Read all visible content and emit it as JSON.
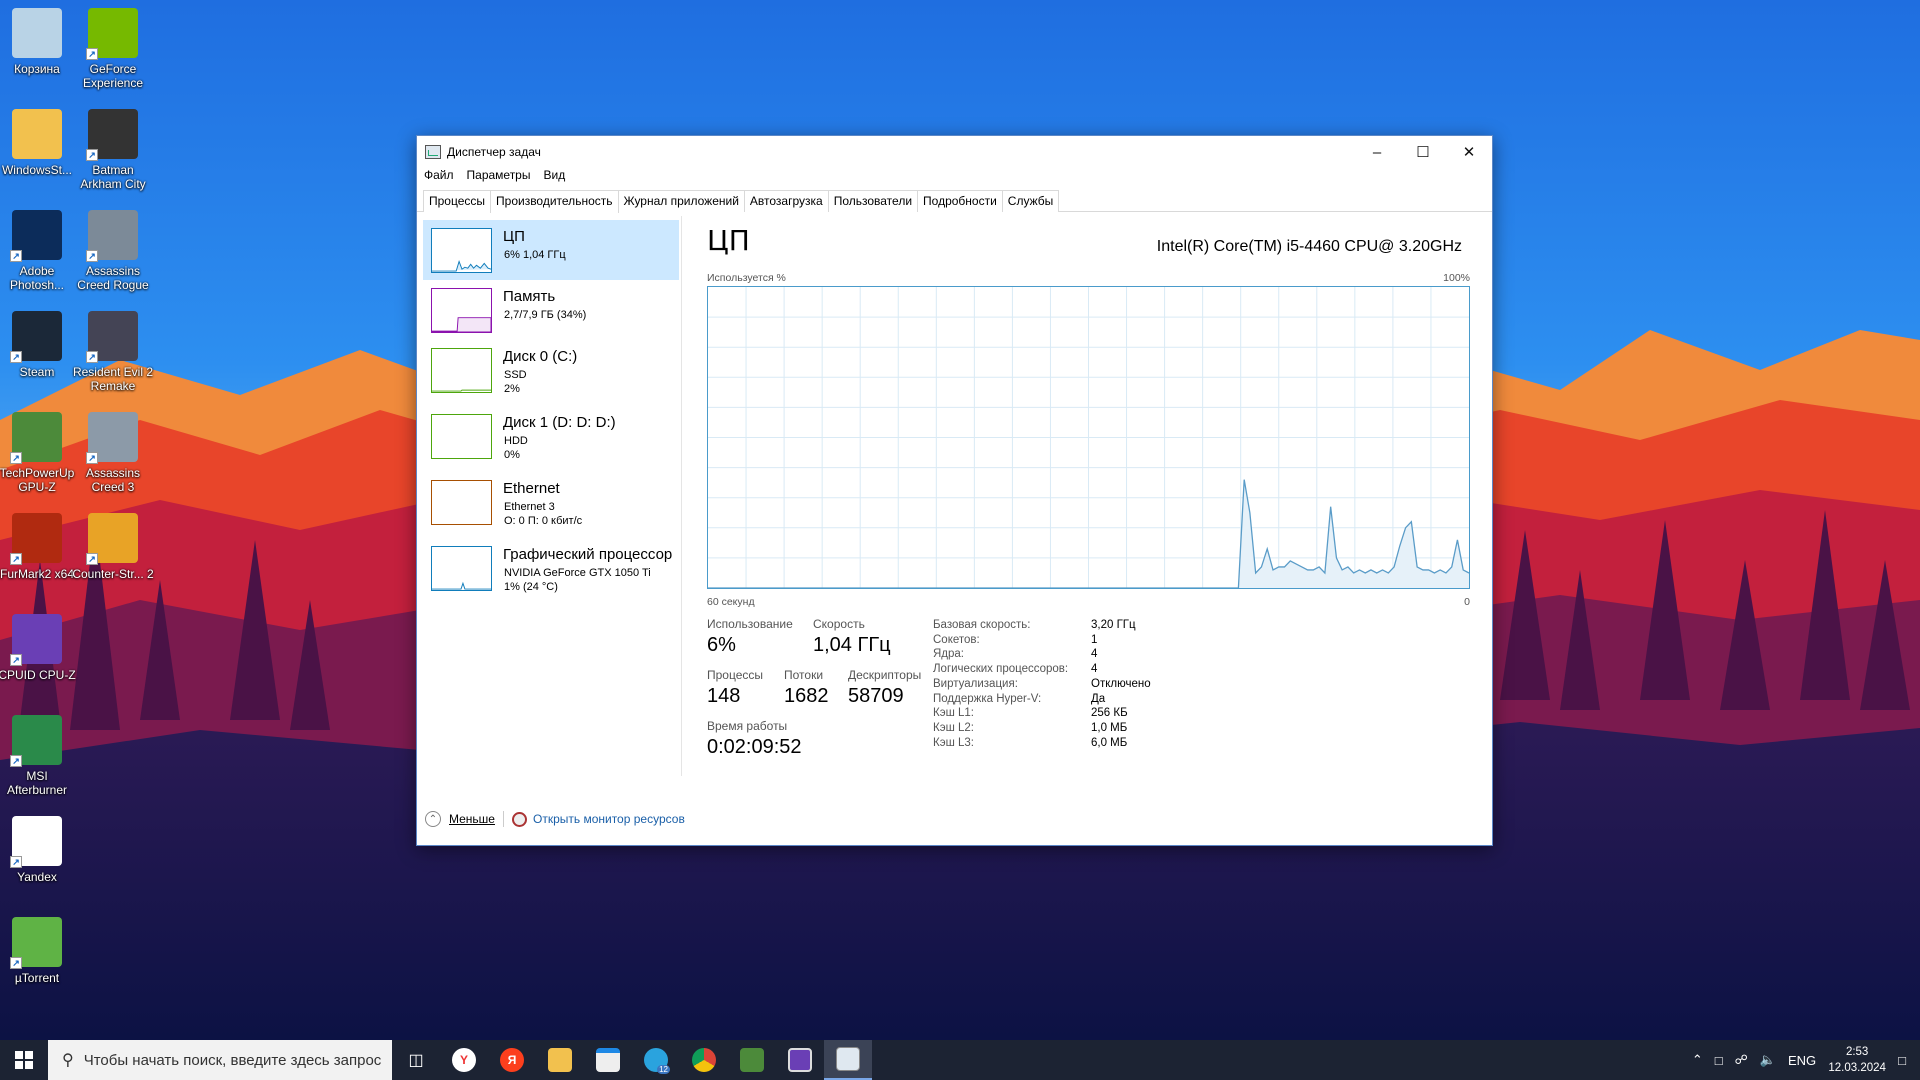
{
  "desktop": {
    "icons": [
      {
        "label": "Корзина",
        "icon": "recycle-bin-icon"
      },
      {
        "label": "GeForce Experience",
        "icon": "geforce-icon"
      },
      {
        "label": "WindowsSt...",
        "icon": "folder-icon"
      },
      {
        "label": "Batman Arkham City",
        "icon": "batman-icon"
      },
      {
        "label": "Adobe Photosh...",
        "icon": "photoshop-icon"
      },
      {
        "label": "Assassins Creed Rogue",
        "icon": "ac-rogue-icon"
      },
      {
        "label": "Steam",
        "icon": "steam-icon"
      },
      {
        "label": "Resident Evil 2 Remake",
        "icon": "re2-icon"
      },
      {
        "label": "TechPowerUp GPU-Z",
        "icon": "gpuz-icon"
      },
      {
        "label": "Assassins Creed 3",
        "icon": "ac3-icon"
      },
      {
        "label": "FurMark2 x64",
        "icon": "furmark-icon"
      },
      {
        "label": "Counter-Str... 2",
        "icon": "cs2-icon"
      },
      {
        "label": "CPUID CPU-Z",
        "icon": "cpuz-icon"
      },
      {
        "label": "MSI Afterburner",
        "icon": "afterburner-icon"
      },
      {
        "label": "Yandex",
        "icon": "yandex-browser-icon"
      },
      {
        "label": "µTorrent",
        "icon": "utorrent-icon"
      }
    ]
  },
  "window": {
    "title": "Диспетчер задач",
    "menu": [
      "Файл",
      "Параметры",
      "Вид"
    ],
    "tabs": [
      "Процессы",
      "Производительность",
      "Журнал приложений",
      "Автозагрузка",
      "Пользователи",
      "Подробности",
      "Службы"
    ],
    "active_tab": "Производительность",
    "sidebar": [
      {
        "name": "ЦП",
        "sub1": "6% 1,04 ГГц",
        "sub2": "",
        "color": "#117dbb"
      },
      {
        "name": "Память",
        "sub1": "2,7/7,9 ГБ (34%)",
        "sub2": "",
        "color": "#8b12ae"
      },
      {
        "name": "Диск 0 (C:)",
        "sub1": "SSD",
        "sub2": "2%",
        "color": "#4da60c"
      },
      {
        "name": "Диск 1 (D: D: D:)",
        "sub1": "HDD",
        "sub2": "0%",
        "color": "#4da60c"
      },
      {
        "name": "Ethernet",
        "sub1": "Ethernet 3",
        "sub2": "О: 0 П: 0 кбит/с",
        "color": "#a74f01"
      },
      {
        "name": "Графический процессор",
        "sub1": "NVIDIA GeForce GTX 1050 Ti",
        "sub2": "1% (24 °C)",
        "color": "#117dbb"
      }
    ],
    "cpu": {
      "title": "ЦП",
      "model": "Intel(R) Core(TM) i5-4460 CPU@ 3.20GHz",
      "graph_label_left": "Используется %",
      "graph_label_right": "100%",
      "graph_time_left": "60 секунд",
      "graph_time_right": "0",
      "usage_label": "Использование",
      "usage": "6%",
      "speed_label": "Скорость",
      "speed": "1,04 ГГц",
      "processes_label": "Процессы",
      "processes": "148",
      "threads_label": "Потоки",
      "threads": "1682",
      "handles_label": "Дескрипторы",
      "handles": "58709",
      "uptime_label": "Время работы",
      "uptime": "0:02:09:52",
      "specs": [
        {
          "k": "Базовая скорость:",
          "v": "3,20 ГГц"
        },
        {
          "k": "Сокетов:",
          "v": "1"
        },
        {
          "k": "Ядра:",
          "v": "4"
        },
        {
          "k": "Логических процессоров:",
          "v": "4"
        },
        {
          "k": "Виртуализация:",
          "v": "Отключено"
        },
        {
          "k": "Поддержка Hyper-V:",
          "v": "Да"
        },
        {
          "k": "Кэш L1:",
          "v": "256 КБ"
        },
        {
          "k": "Кэш L2:",
          "v": "1,0 МБ"
        },
        {
          "k": "Кэш L3:",
          "v": "6,0 МБ"
        }
      ],
      "usage_history_percent": [
        0,
        0,
        0,
        0,
        0,
        0,
        0,
        0,
        0,
        0,
        0,
        0,
        0,
        0,
        0,
        0,
        0,
        0,
        0,
        0,
        0,
        0,
        0,
        0,
        0,
        0,
        0,
        0,
        0,
        0,
        0,
        0,
        0,
        0,
        0,
        0,
        0,
        0,
        0,
        0,
        0,
        0,
        0,
        0,
        0,
        0,
        0,
        0,
        0,
        0,
        0,
        0,
        0,
        0,
        0,
        0,
        0,
        0,
        0,
        0,
        0,
        0,
        0,
        0,
        0,
        0,
        0,
        0,
        0,
        0,
        0,
        0,
        0,
        0,
        0,
        0,
        0,
        0,
        0,
        0,
        0,
        0,
        0,
        0,
        0,
        0,
        0,
        0,
        0,
        0,
        0,
        0,
        0,
        36,
        25,
        5,
        7,
        13,
        6,
        7,
        7,
        9,
        8,
        7,
        6,
        6,
        7,
        5,
        27,
        10,
        6,
        7,
        5,
        6,
        5,
        6,
        5,
        6,
        5,
        7,
        14,
        20,
        22,
        7,
        6,
        6,
        5,
        6,
        5,
        7,
        16,
        6,
        5
      ]
    },
    "footer": {
      "less": "Меньше",
      "resource_monitor": "Открыть монитор ресурсов"
    }
  },
  "taskbar": {
    "search_placeholder": "Чтобы начать поиск, введите здесь запрос",
    "apps": [
      "task-view-icon",
      "yandex-browser-icon",
      "yandex-icon",
      "file-explorer-icon",
      "store-icon",
      "telegram-icon",
      "chrome-icon",
      "gpuz-icon",
      "cpuz-icon",
      "task-manager-icon"
    ],
    "telegram_badge": "12",
    "lang": "ENG",
    "time": "2:53",
    "date": "12.03.2024"
  }
}
